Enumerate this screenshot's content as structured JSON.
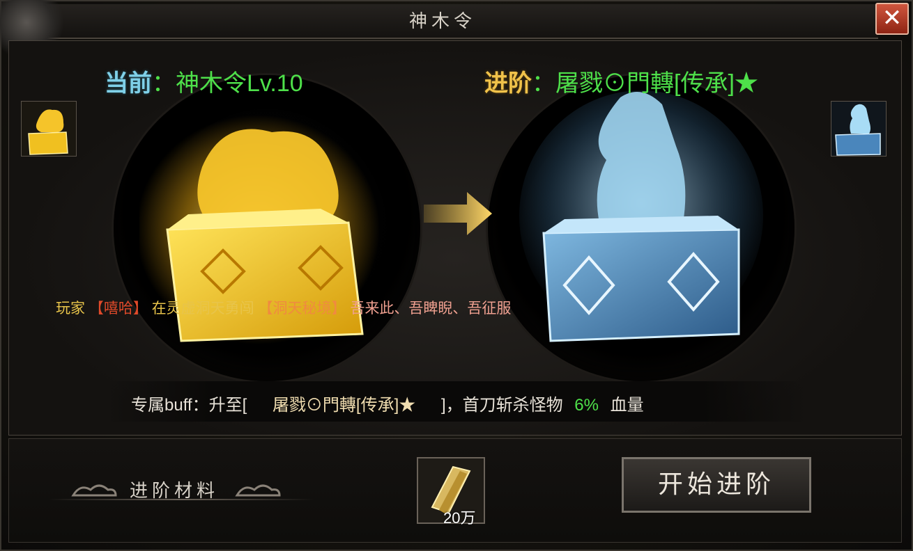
{
  "window": {
    "title": "神木令"
  },
  "current": {
    "prefix": "当前",
    "colon": "：",
    "name": "神木令Lv.10"
  },
  "next": {
    "prefix": "进阶",
    "colon": "：",
    "name": "屠戮⊙門轉[传承]★"
  },
  "broadcast": {
    "p1": "玩家",
    "p2": "【嘻哈】",
    "p3": "在灵虚洞天勇闯",
    "p4": "【洞天秘境】",
    "p5": "吾来此、吾睥睨、吾征服"
  },
  "buff": {
    "label": "专属buff：升至[",
    "item": "屠戮⊙門轉[传承]★",
    "mid": "]，首刀斩杀怪物",
    "percent": "6%",
    "unit": "血量"
  },
  "materials": {
    "label": "进阶材料",
    "count": "20万"
  },
  "buttons": {
    "close": "✕",
    "advance": "开始进阶"
  },
  "colors": {
    "gold": "#f0c24a",
    "ice": "#9fd4f0",
    "green": "#4ee04a",
    "close_red": "#c0422e"
  }
}
